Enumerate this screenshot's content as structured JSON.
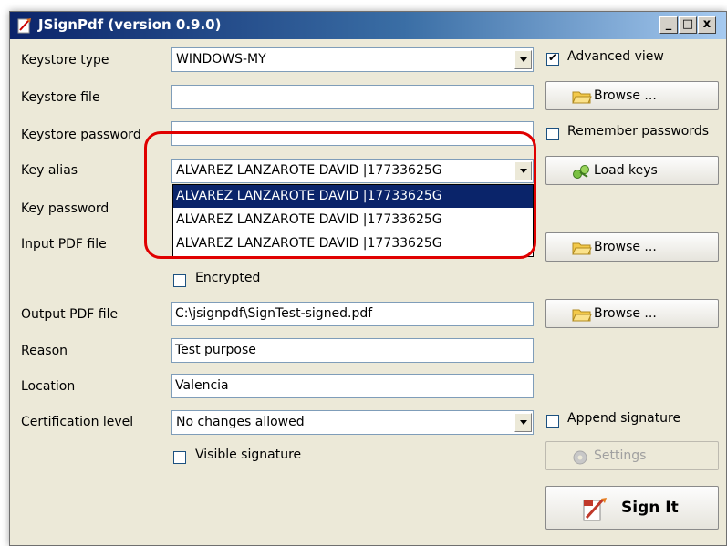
{
  "window": {
    "title": "JSignPdf (version 0.9.0)",
    "minimize": "_",
    "maximize": "□",
    "close": "x"
  },
  "labels": {
    "keystore_type": "Keystore type",
    "keystore_file": "Keystore file",
    "keystore_password": "Keystore password",
    "key_alias": "Key alias",
    "key_password": "Key password",
    "input_pdf": "Input PDF file",
    "output_pdf": "Output PDF file",
    "reason": "Reason",
    "location": "Location",
    "certification_level": "Certification level"
  },
  "fields": {
    "keystore_type": "WINDOWS-MY",
    "keystore_file": "",
    "keystore_password": "",
    "key_alias": "ALVAREZ LANZAROTE DAVID |17733625G",
    "output_pdf": "C:\\jsignpdf\\SignTest-signed.pdf",
    "reason": "Test purpose",
    "location": "Valencia",
    "certification_level": "No changes allowed"
  },
  "key_alias_options": [
    "ALVAREZ LANZAROTE DAVID |17733625G",
    "ALVAREZ LANZAROTE DAVID |17733625G",
    "ALVAREZ LANZAROTE DAVID |17733625G"
  ],
  "checkboxes": {
    "advanced_view": {
      "label": "Advanced view",
      "checked": true
    },
    "remember_passwords": {
      "label": "Remember passwords",
      "checked": false
    },
    "encrypted": {
      "label": "Encrypted",
      "checked": false
    },
    "append_signature": {
      "label": "Append signature",
      "checked": false
    },
    "visible_signature": {
      "label": "Visible signature",
      "checked": false
    }
  },
  "buttons": {
    "browse": "Browse ...",
    "load_keys": "Load keys",
    "settings": "Settings",
    "sign_it": "Sign It"
  },
  "colors": {
    "highlight": "#e00000",
    "selection": "#0a246a"
  }
}
